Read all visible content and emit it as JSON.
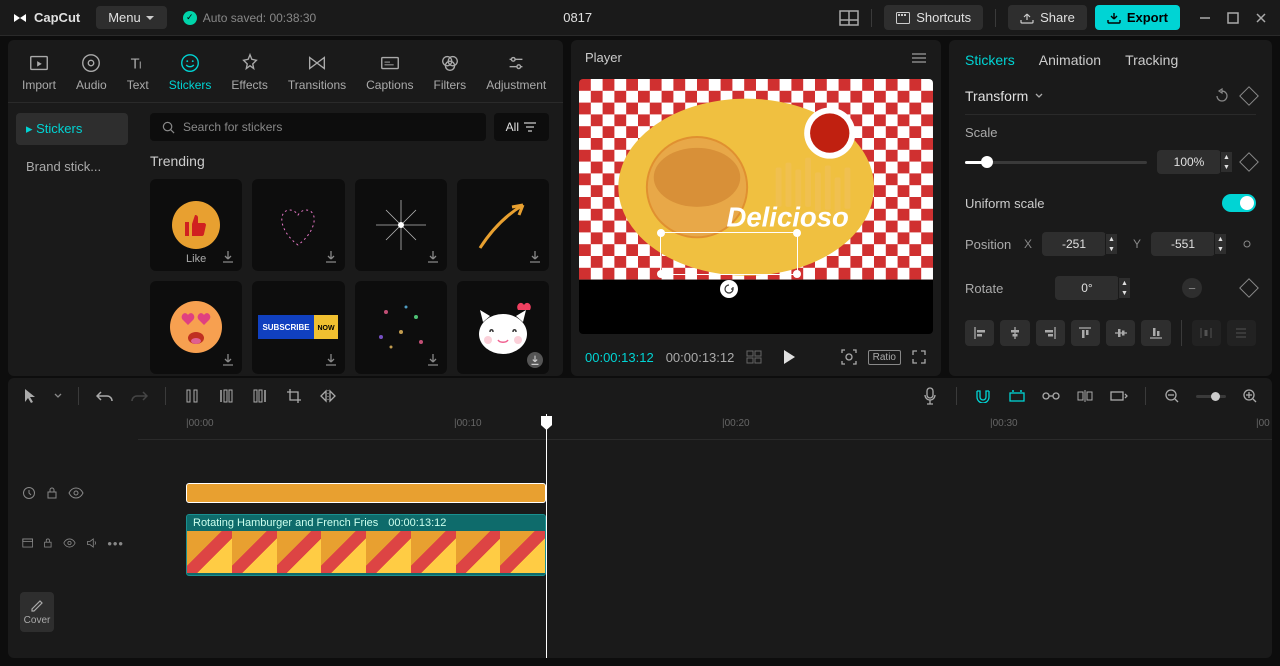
{
  "titlebar": {
    "app_name": "CapCut",
    "menu_label": "Menu",
    "autosave_text": "Auto saved: 00:38:30",
    "project_title": "0817",
    "shortcuts_label": "Shortcuts",
    "share_label": "Share",
    "export_label": "Export"
  },
  "tool_tabs": {
    "import": "Import",
    "audio": "Audio",
    "text": "Text",
    "stickers": "Stickers",
    "effects": "Effects",
    "transitions": "Transitions",
    "captions": "Captions",
    "filters": "Filters",
    "adjustment": "Adjustment"
  },
  "sticker_nav": {
    "stickers": "Stickers",
    "brand": "Brand stick..."
  },
  "sticker_panel": {
    "search_placeholder": "Search for stickers",
    "all_label": "All",
    "section_title": "Trending",
    "like_label": "Like"
  },
  "player": {
    "title": "Player",
    "overlay_text": "Delicioso",
    "time_current": "00:00:13:12",
    "time_total": "00:00:13:12",
    "ratio_label": "Ratio"
  },
  "inspector": {
    "tabs": {
      "stickers": "Stickers",
      "animation": "Animation",
      "tracking": "Tracking"
    },
    "transform_label": "Transform",
    "scale_label": "Scale",
    "scale_value": "100%",
    "uniform_label": "Uniform scale",
    "position_label": "Position",
    "pos_x_label": "X",
    "pos_x_value": "-251",
    "pos_y_label": "Y",
    "pos_y_value": "-551",
    "rotate_label": "Rotate",
    "rotate_value": "0°"
  },
  "timeline": {
    "ticks": [
      "|00:00",
      "|00:10",
      "|00:20",
      "|00:30",
      "|00"
    ],
    "clip_title": "Rotating Hamburger and French Fries",
    "clip_duration": "00:00:13:12",
    "cover_label": "Cover"
  }
}
